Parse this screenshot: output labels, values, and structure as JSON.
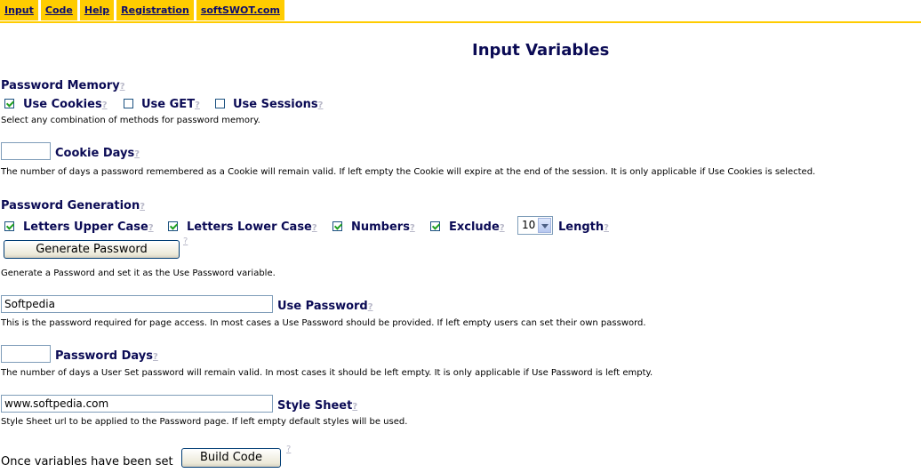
{
  "nav": {
    "items": [
      "Input",
      "Code",
      "Help",
      "Registration",
      "softSWOT.com"
    ]
  },
  "page_title": "Input Variables",
  "help_mark": "?",
  "password_memory": {
    "title": "Password Memory",
    "options": [
      {
        "label": "Use Cookies",
        "checked": true
      },
      {
        "label": "Use GET",
        "checked": false
      },
      {
        "label": "Use Sessions",
        "checked": false
      }
    ],
    "description": "Select any combination of methods for password memory."
  },
  "cookie_days": {
    "label": "Cookie Days",
    "value": "",
    "description": "The number of days a password remembered as a Cookie will remain valid. If left empty the Cookie will expire at the end of the session. It is only applicable if Use Cookies is selected."
  },
  "password_generation": {
    "title": "Password Generation",
    "options": [
      {
        "label": "Letters Upper Case",
        "checked": true
      },
      {
        "label": "Letters Lower Case",
        "checked": true
      },
      {
        "label": "Numbers",
        "checked": true
      },
      {
        "label": "Exclude",
        "checked": true
      }
    ],
    "length_value": "10",
    "length_label": "Length",
    "generate_button": "Generate Password",
    "description": "Generate a Password and set it as the Use Password variable."
  },
  "use_password": {
    "label": "Use Password",
    "value": "Softpedia",
    "description": "This is the password required for page access. In most cases a Use Password should be provided. If left empty users can set their own password."
  },
  "password_days": {
    "label": "Password Days",
    "value": "",
    "description": "The number of days a User Set password will remain valid. In most cases it should be left empty. It is only applicable if Use Password is left empty."
  },
  "style_sheet": {
    "label": "Style Sheet",
    "value": "www.softpedia.com",
    "description": "Style Sheet url to be applied to the Password page. If left empty default styles will be used."
  },
  "build": {
    "prompt": "Once variables have been set",
    "button": "Build Code"
  }
}
